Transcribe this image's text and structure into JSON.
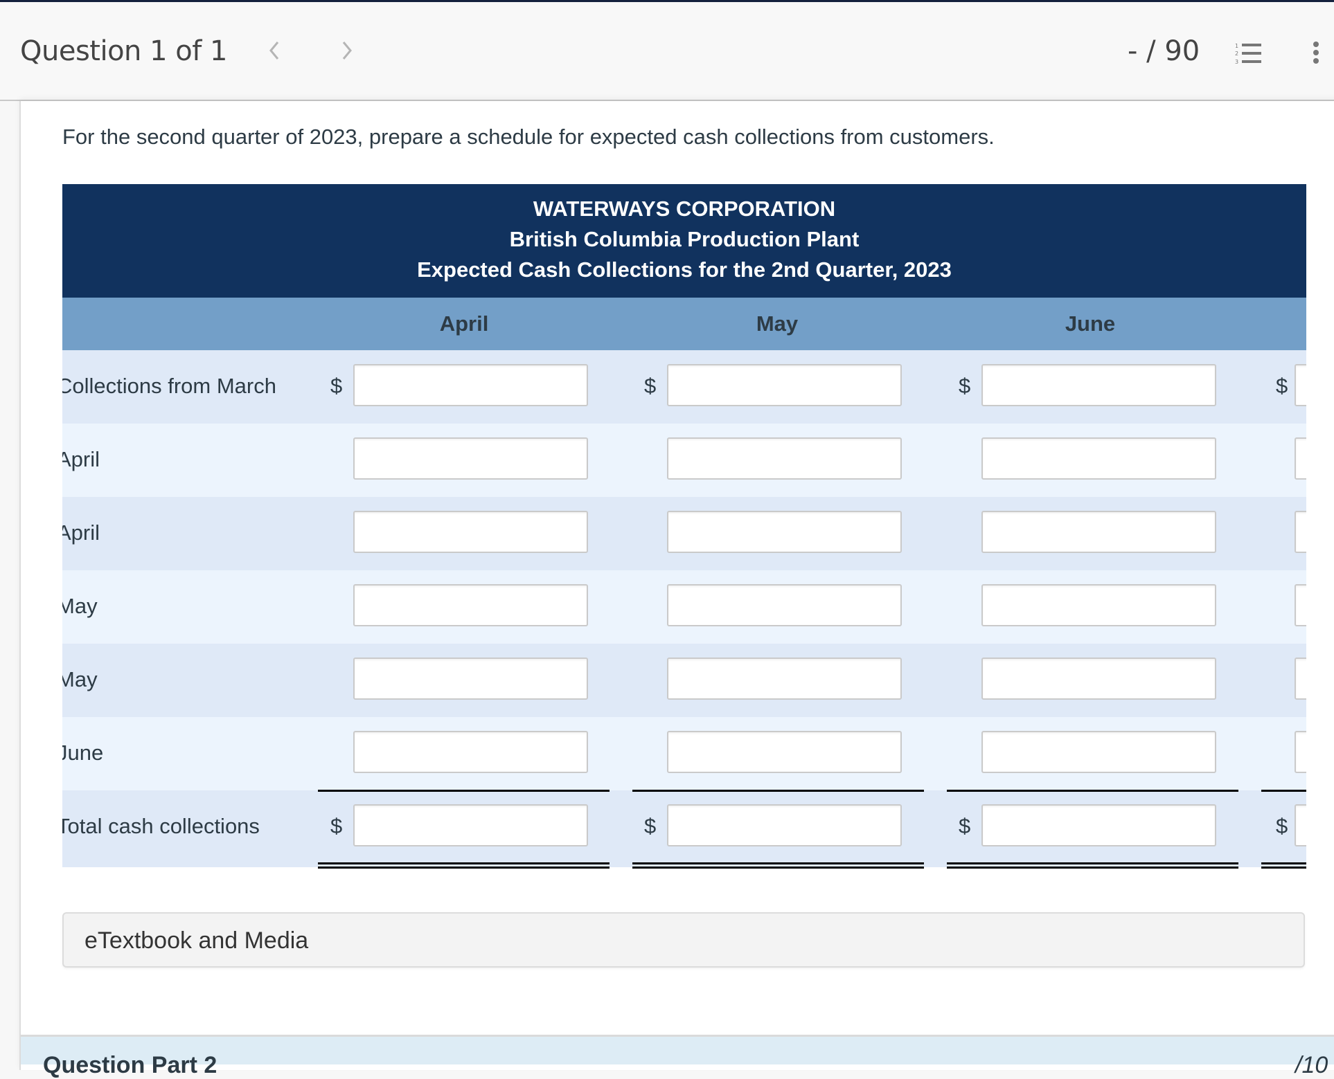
{
  "header": {
    "question_label": "Question 1 of 1",
    "prev_glyph": "<",
    "next_glyph": ">",
    "score": "- / 90",
    "list_icon": "numbered-list-icon",
    "more_icon": "more-vertical-icon"
  },
  "prompt": "For the second quarter of 2023, prepare a schedule for expected cash collections from customers.",
  "table": {
    "title_lines": [
      "WATERWAYS CORPORATION",
      "British Columbia Production Plant",
      "Expected Cash Collections for the 2nd Quarter, 2023"
    ],
    "columns": [
      "April",
      "May",
      "June",
      ""
    ],
    "currency_symbol": "$",
    "rows": [
      {
        "label": "Collections from March",
        "show_dollar": true,
        "values": [
          "",
          "",
          "",
          ""
        ]
      },
      {
        "label": "April",
        "show_dollar": false,
        "values": [
          "",
          "",
          "",
          ""
        ]
      },
      {
        "label": "April",
        "show_dollar": false,
        "values": [
          "",
          "",
          "",
          ""
        ]
      },
      {
        "label": "May",
        "show_dollar": false,
        "values": [
          "",
          "",
          "",
          ""
        ]
      },
      {
        "label": "May",
        "show_dollar": false,
        "values": [
          "",
          "",
          "",
          ""
        ]
      },
      {
        "label": "June",
        "show_dollar": false,
        "values": [
          "",
          "",
          "",
          ""
        ]
      }
    ],
    "total_row": {
      "label": "Total cash collections",
      "show_dollar": true,
      "values": [
        "",
        "",
        "",
        ""
      ]
    }
  },
  "etextbook_label": "eTextbook and Media",
  "next_part": {
    "title": "Question Part 2",
    "score": "/10"
  },
  "colors": {
    "header_dark": "#11325e",
    "header_light": "#739fc8",
    "row_even": "#dfe9f7",
    "row_odd": "#ecf4fd"
  }
}
